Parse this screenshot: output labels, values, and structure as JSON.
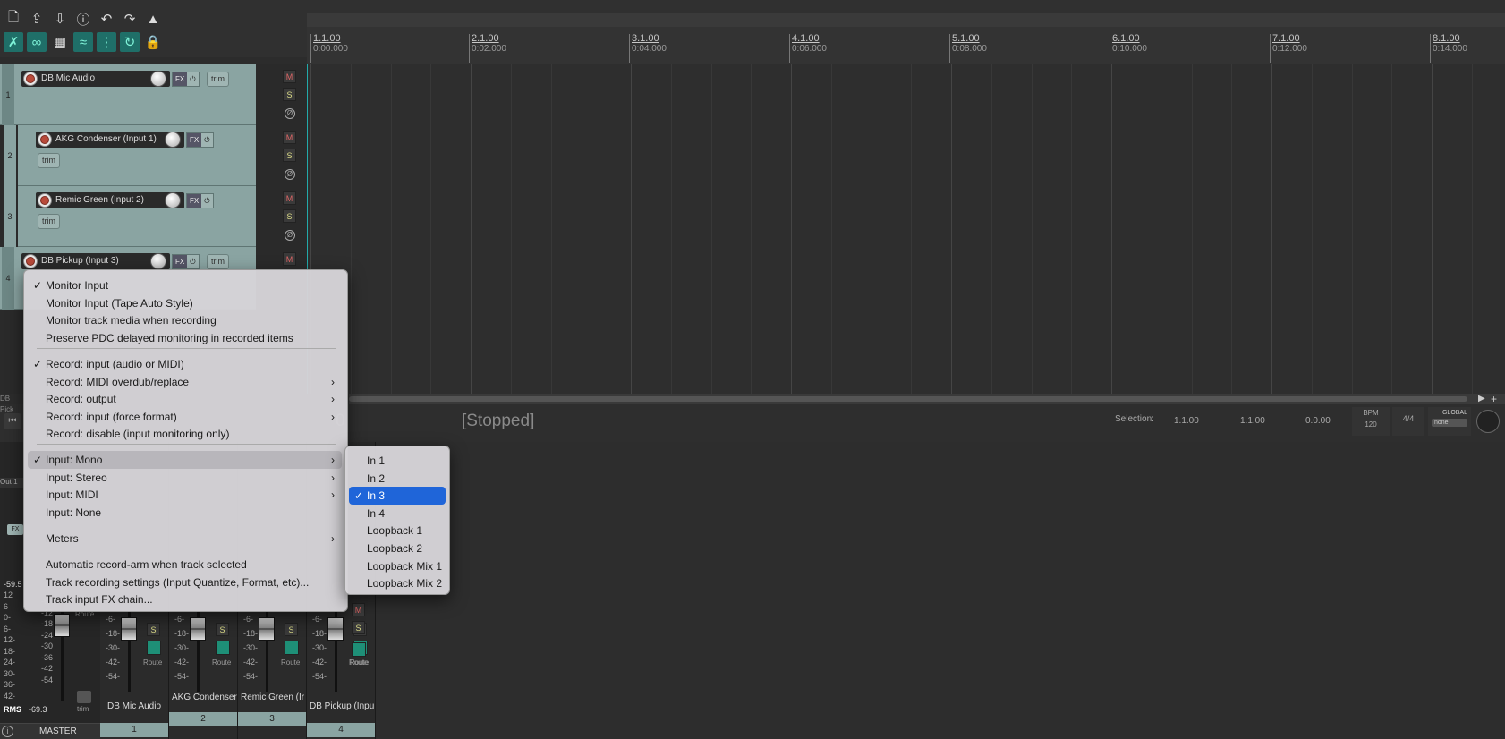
{
  "toolbar": {
    "row1": [
      "new-project-icon",
      "save-icon",
      "load-icon",
      "info-icon",
      "undo-icon",
      "redo-icon",
      "metronome-icon"
    ],
    "row2": [
      "ripple-icon",
      "link-icon",
      "grid-icon",
      "envelope-icon",
      "snap-icon",
      "loop-icon",
      "lock-icon"
    ]
  },
  "ruler": {
    "marks": [
      {
        "bar": "1.1.00",
        "time": "0:00.000"
      },
      {
        "bar": "2.1.00",
        "time": "0:02.000"
      },
      {
        "bar": "3.1.00",
        "time": "0:04.000"
      },
      {
        "bar": "4.1.00",
        "time": "0:06.000"
      },
      {
        "bar": "5.1.00",
        "time": "0:08.000"
      },
      {
        "bar": "6.1.00",
        "time": "0:10.000"
      },
      {
        "bar": "7.1.00",
        "time": "0:12.000"
      },
      {
        "bar": "8.1.00",
        "time": "0:14.000"
      }
    ]
  },
  "tracks": [
    {
      "num": "1",
      "name": "DB Mic Audio",
      "fx": "FX",
      "trim": "trim"
    },
    {
      "num": "2",
      "name": "AKG Condenser (Input 1)",
      "fx": "FX",
      "trim": "trim"
    },
    {
      "num": "3",
      "name": "Remic Green (Input 2)",
      "fx": "FX",
      "trim": "trim"
    },
    {
      "num": "4",
      "name": "DB Pickup (Input 3)",
      "fx": "FX",
      "trim": "trim"
    }
  ],
  "buttons": {
    "mute": "M",
    "solo": "S",
    "phase": "Ø"
  },
  "transport": {
    "time": "0",
    "status": "[Stopped]",
    "selection_label": "Selection:",
    "selection_start": "1.1.00",
    "selection_end": "1.1.00",
    "selection_length": "0.0.00",
    "bpm_label": "BPM",
    "bpm": "120",
    "timesig": "4/4",
    "global_label": "GLOBAL",
    "global_value": "none"
  },
  "mixer": {
    "peak": "-59.5",
    "rms_label": "RMS",
    "rms": "-69.3",
    "master_label": "MASTER",
    "master_scale_left": [
      "12",
      "6",
      "0-",
      "6-",
      "12-",
      "18-",
      "24-",
      "30-",
      "36-",
      "42-"
    ],
    "master_scale_mid": [
      "-6",
      "-12",
      "-18",
      "-24",
      "-30",
      "-36",
      "-42",
      "-54"
    ],
    "strip_scale": [
      "-6-",
      "-18-",
      "-30-",
      "-42-",
      "-54-"
    ],
    "route_label": "Route",
    "trim_label": "trim",
    "out_label": "Out 1",
    "fx_label": "FX",
    "db_label": "DB Pick",
    "strips": [
      {
        "name": "DB Mic Audio",
        "num": "1"
      },
      {
        "name": "AKG Condenser",
        "num": "2"
      },
      {
        "name": "Remic Green (Ir",
        "num": "3"
      },
      {
        "name": "DB Pickup (Inpu",
        "num": "4"
      }
    ]
  },
  "menu": {
    "items": [
      {
        "label": "Monitor Input",
        "checked": true,
        "sub": false
      },
      {
        "label": "Monitor Input (Tape Auto Style)",
        "checked": false,
        "sub": false
      },
      {
        "label": "Monitor track media when recording",
        "checked": false,
        "sub": false
      },
      {
        "label": "Preserve PDC delayed monitoring in recorded items",
        "checked": false,
        "sub": false
      },
      {
        "label": "Record: input (audio or MIDI)",
        "checked": true,
        "sub": false
      },
      {
        "label": "Record: MIDI overdub/replace",
        "checked": false,
        "sub": true
      },
      {
        "label": "Record: output",
        "checked": false,
        "sub": true
      },
      {
        "label": "Record: input (force format)",
        "checked": false,
        "sub": true
      },
      {
        "label": "Record: disable (input monitoring only)",
        "checked": false,
        "sub": false
      },
      {
        "label": "Input: Mono",
        "checked": true,
        "sub": true
      },
      {
        "label": "Input: Stereo",
        "checked": false,
        "sub": true
      },
      {
        "label": "Input: MIDI",
        "checked": false,
        "sub": true
      },
      {
        "label": "Input: None",
        "checked": false,
        "sub": false
      },
      {
        "label": "Meters",
        "checked": false,
        "sub": true
      },
      {
        "label": "Automatic record-arm when track selected",
        "checked": false,
        "sub": false
      },
      {
        "label": "Track recording settings (Input Quantize, Format, etc)...",
        "checked": false,
        "sub": false
      },
      {
        "label": "Track input FX chain...",
        "checked": false,
        "sub": false
      }
    ],
    "check_glyph": "✓",
    "arrow_glyph": "›"
  },
  "submenu": {
    "items": [
      {
        "label": "In 1",
        "checked": false
      },
      {
        "label": "In 2",
        "checked": false
      },
      {
        "label": "In 3",
        "checked": true
      },
      {
        "label": "In 4",
        "checked": false
      },
      {
        "label": "Loopback 1",
        "checked": false
      },
      {
        "label": "Loopback 2",
        "checked": false
      },
      {
        "label": "Loopback Mix 1",
        "checked": false
      },
      {
        "label": "Loopback Mix 2",
        "checked": false
      }
    ]
  },
  "colors": {
    "track": "#8aa4a2",
    "highlight": "#1f65d9",
    "accent": "#1f6f68"
  }
}
